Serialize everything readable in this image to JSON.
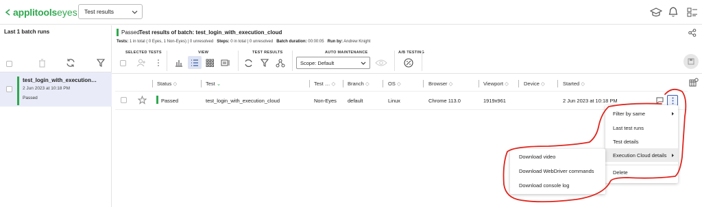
{
  "app": {
    "logo_text": "applitools",
    "logo_suffix": "eyes",
    "view_select": "Test results"
  },
  "left": {
    "title": "Last 1 batch runs",
    "batch": {
      "name": "test_login_with_execution…",
      "date": "2 Jun 2023 at 10:18 PM",
      "status": "Passed"
    }
  },
  "header": {
    "status": "Passed",
    "title_prefix": "Test results of batch:",
    "batch_name": "test_login_with_execution_cloud",
    "meta": {
      "tests_label": "Tests:",
      "tests_value": "1 in total ( 0 Eyes, 1 Non-Eyes)",
      "tests_unresolved": "0 unresolved",
      "steps_label": "Steps:",
      "steps_value": "0 in total",
      "steps_unresolved": "0 unresolved",
      "duration_label": "Batch duration:",
      "duration_value": "00:00:05",
      "runby_label": "Run by:",
      "runby_value": "Andrew Knight"
    }
  },
  "toolbar": {
    "groups": [
      "SELECTED TESTS",
      "VIEW",
      "TEST RESULTS",
      "AUTO MAINTENANCE",
      "A/B TESTING"
    ],
    "scope": "Scope: Default"
  },
  "table": {
    "headers": [
      "Status",
      "Test",
      "Test …",
      "Branch",
      "OS",
      "Browser",
      "Viewport",
      "Device",
      "Started"
    ],
    "row": {
      "status": "Passed",
      "test": "test_login_with_execution_cloud",
      "test_type": "Non-Eyes",
      "branch": "default",
      "os": "Linux",
      "browser": "Chrome 113.0",
      "viewport": "1919x961",
      "device": "",
      "started": "2 Jun 2023 at 10:18 PM"
    }
  },
  "context_menu": {
    "items": [
      "Filter by same",
      "Last test runs",
      "Test details",
      "Execution Cloud details",
      "Delete"
    ]
  },
  "submenu": {
    "items": [
      "Download video",
      "Download WebDriver commands",
      "Download console log"
    ]
  },
  "colors": {
    "accent_green": "#2fa84f",
    "annotation_red": "#e0231b",
    "selection_bg": "#e9ecf8"
  }
}
